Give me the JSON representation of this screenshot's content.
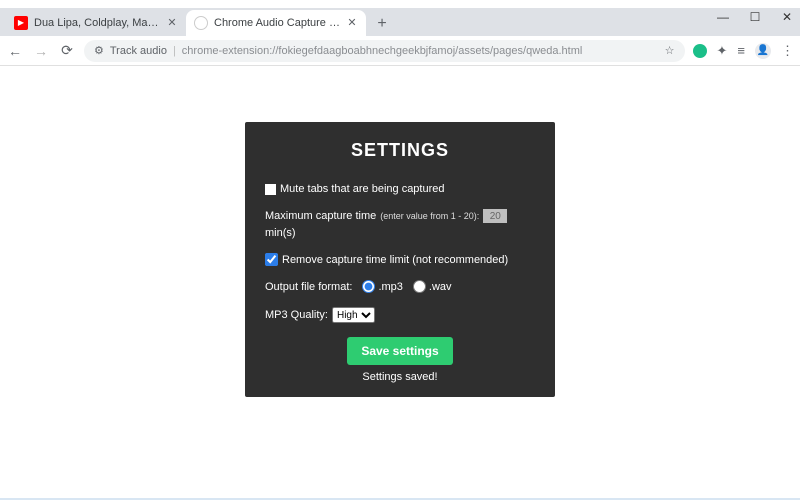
{
  "window": {
    "controls": {
      "min": "—",
      "max": "☐",
      "close": "✕"
    }
  },
  "tabs": [
    {
      "title": "Dua Lipa, Coldplay, Martin G",
      "favicon": "yt"
    },
    {
      "title": "Chrome Audio Capture Options",
      "favicon": "ext"
    }
  ],
  "newtab": "+",
  "toolbar": {
    "back": "←",
    "forward": "→",
    "reload": "⟳",
    "lock": "⚙",
    "url_prefix": "Track audio",
    "url_rest": "chrome-extension://fokiegefdaagboabhnechgeekbjfamoj/assets/pages/qweda.html",
    "star": "☆",
    "dots": "⋮"
  },
  "settings": {
    "title": "SETTINGS",
    "mute_label": "Mute tabs that are being captured",
    "mute_checked": false,
    "max_time_label": "Maximum capture time",
    "max_time_hint": "(enter value from 1 - 20):",
    "max_time_value": "20",
    "max_time_unit": "min(s)",
    "remove_limit_label": "Remove capture time limit (not recommended)",
    "remove_limit_checked": true,
    "format_label": "Output file format:",
    "format_options": {
      "mp3": ".mp3",
      "wav": ".wav"
    },
    "format_selected": "mp3",
    "quality_label": "MP3 Quality:",
    "quality_value": "High",
    "save_button": "Save settings",
    "saved_message": "Settings saved!"
  }
}
